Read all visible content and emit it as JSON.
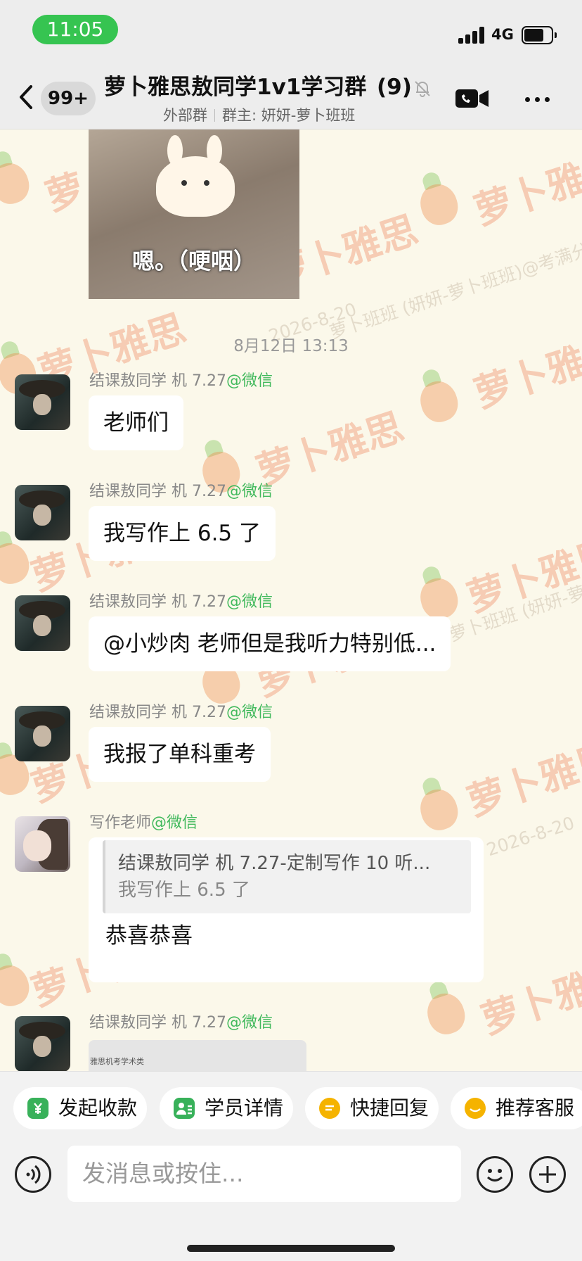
{
  "status_bar": {
    "time": "11:05",
    "network": "4G",
    "battery_level": 0.72
  },
  "header": {
    "badge": "99+",
    "title": "萝卜雅思敖同学1v1学习群",
    "title_count": "(9)",
    "subtitle_tag": "外部群",
    "subtitle_owner": "群主: 妍妍-萝卜班班"
  },
  "watermark": {
    "brand": "萝卜雅思",
    "owner": "萝卜班班 (妍妍-萝卜班班)@考满分",
    "date": "2026-8-20",
    "colors": {
      "text": "#ec7346",
      "carrot_body": "#ef8948",
      "carrot_leaf": "#7ac14f"
    }
  },
  "chat": {
    "sticker_caption": "嗯。（哽咽）",
    "timestamp": "8月12日 13:13",
    "messages": [
      {
        "sender": "结课敖同学 机 7.27",
        "source": "@微信",
        "text": "老师们"
      },
      {
        "sender": "结课敖同学 机 7.27",
        "source": "@微信",
        "text": "我写作上 6.5 了"
      },
      {
        "sender": "结课敖同学 机 7.27",
        "source": "@微信",
        "text": "@小炒肉 老师但是我听力特别低..."
      },
      {
        "sender": "结课敖同学 机 7.27",
        "source": "@微信",
        "text": "我报了单科重考"
      },
      {
        "sender": "写作老师",
        "source": "@微信",
        "quote_title": "结课敖同学 机 7.27-定制写作 10 听...",
        "quote_text": "我写作上 6.5 了",
        "text": "恭喜恭喜"
      },
      {
        "sender": "结课敖同学 机 7.27",
        "source": "@微信",
        "image_caption": "雅思机考学术类"
      }
    ]
  },
  "quick_actions": [
    {
      "label": "发起收款",
      "icon": "yen-shield-icon",
      "color": "#38b15a"
    },
    {
      "label": "学员详情",
      "icon": "person-list-icon",
      "color": "#38b15a"
    },
    {
      "label": "快捷回复",
      "icon": "quick-reply-icon",
      "color": "#f5b300"
    },
    {
      "label": "推荐客服",
      "icon": "service-icon",
      "color": "#f5b300"
    }
  ],
  "input": {
    "placeholder": "发消息或按住..."
  },
  "colors": {
    "accent_green": "#36c451",
    "source_green": "#41b95c",
    "background": "#fbf8ea"
  }
}
